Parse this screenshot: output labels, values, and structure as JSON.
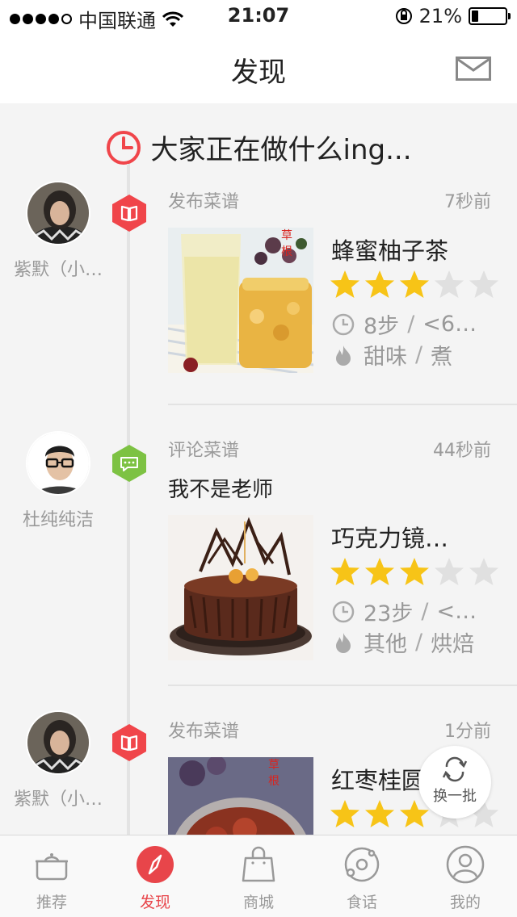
{
  "status_bar": {
    "carrier": "中国联通",
    "time": "21:07",
    "battery": "21%",
    "battery_level": 0.21
  },
  "header": {
    "title": "发现",
    "mail_icon": "mail-icon"
  },
  "feed": {
    "heading": "大家正在做什么ing...",
    "items": [
      {
        "user": "紫默（小…",
        "action": "发布菜谱",
        "time": "7秒前",
        "comment": "",
        "type_icon": "book-icon",
        "type_color": "#f0454a",
        "recipe": {
          "name": "蜂蜜柚子茶",
          "rating": 3,
          "steps": "8步",
          "duration": "<6…",
          "taste": "甜味",
          "method": "煮"
        }
      },
      {
        "user": "杜纯纯洁",
        "action": "评论菜谱",
        "time": "44秒前",
        "comment": "我不是老师",
        "type_icon": "comment-icon",
        "type_color": "#7dc243",
        "recipe": {
          "name": "巧克力镜…",
          "rating": 3,
          "steps": "23步",
          "duration": "<…",
          "taste": "其他",
          "method": "烘焙"
        }
      },
      {
        "user": "紫默（小…",
        "action": "发布菜谱",
        "time": "1分前",
        "comment": "",
        "type_icon": "book-icon",
        "type_color": "#f0454a",
        "recipe": {
          "name": "红枣桂圆",
          "rating": 3
        }
      }
    ]
  },
  "refresh_button": {
    "label": "换一批"
  },
  "tabs": [
    {
      "label": "推荐",
      "icon": "pot-icon",
      "active": false
    },
    {
      "label": "发现",
      "icon": "compass-icon",
      "active": true
    },
    {
      "label": "商城",
      "icon": "shopping-bag-icon",
      "active": false
    },
    {
      "label": "食话",
      "icon": "planet-icon",
      "active": false
    },
    {
      "label": "我的",
      "icon": "user-icon",
      "active": false
    }
  ],
  "colors": {
    "accent": "#e8454a",
    "green": "#7dc243",
    "star": "#f7c417",
    "star_empty": "#e0e0e0"
  }
}
